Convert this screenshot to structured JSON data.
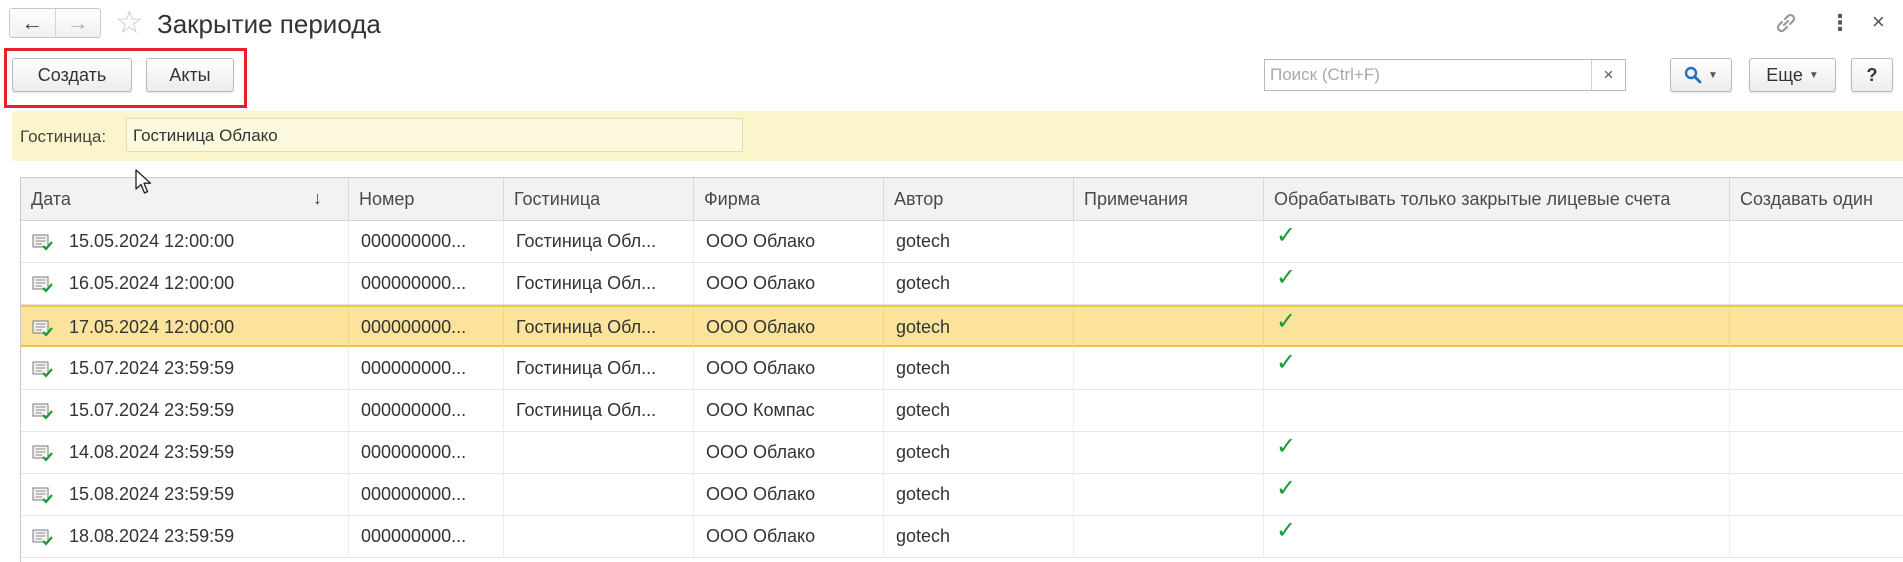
{
  "window": {
    "title": "Закрытие периода",
    "back_icon": "arrow-left-icon",
    "forward_icon": "arrow-right-icon",
    "favorite_icon": "star-icon",
    "link_icon": "link-icon",
    "more_icon": "vertical-dots-icon",
    "close_label": "×"
  },
  "toolbar": {
    "create_label": "Создать",
    "acts_label": "Акты",
    "search_placeholder": "Поиск (Ctrl+F)",
    "search_clear": "×",
    "find_icon": "magnifier-icon",
    "more_label": "Еще",
    "help_label": "?",
    "highlight_color": "#e8202a"
  },
  "filter": {
    "label": "Гостиница:",
    "value": "Гостиница Облако"
  },
  "table": {
    "columns": [
      "Дата",
      "Номер",
      "Гостиница",
      "Фирма",
      "Автор",
      "Примечания",
      "Обрабатывать только закрытые лицевые счета",
      "Создавать один"
    ],
    "sort_indicator": "↓",
    "selected_index": 2,
    "rows": [
      {
        "date": "15.05.2024 12:00:00",
        "number": "000000000...",
        "hotel": "Гостиница Обл...",
        "firm": "ООО Облако",
        "author": "gotech",
        "notes": "",
        "closed_only": true
      },
      {
        "date": "16.05.2024 12:00:00",
        "number": "000000000...",
        "hotel": "Гостиница Обл...",
        "firm": "ООО Облако",
        "author": "gotech",
        "notes": "",
        "closed_only": true
      },
      {
        "date": "17.05.2024 12:00:00",
        "number": "000000000...",
        "hotel": "Гостиница Обл...",
        "firm": "ООО Облако",
        "author": "gotech",
        "notes": "",
        "closed_only": true
      },
      {
        "date": "15.07.2024 23:59:59",
        "number": "000000000...",
        "hotel": "Гостиница Обл...",
        "firm": "ООО Облако",
        "author": "gotech",
        "notes": "",
        "closed_only": true
      },
      {
        "date": "15.07.2024 23:59:59",
        "number": "000000000...",
        "hotel": "Гостиница Обл...",
        "firm": "ООО Компас",
        "author": "gotech",
        "notes": "",
        "closed_only": false
      },
      {
        "date": "14.08.2024 23:59:59",
        "number": "000000000...",
        "hotel": "",
        "firm": "ООО Облако",
        "author": "gotech",
        "notes": "",
        "closed_only": true
      },
      {
        "date": "15.08.2024 23:59:59",
        "number": "000000000...",
        "hotel": "",
        "firm": "ООО Облако",
        "author": "gotech",
        "notes": "",
        "closed_only": true
      },
      {
        "date": "18.08.2024 23:59:59",
        "number": "000000000...",
        "hotel": "",
        "firm": "ООО Облако",
        "author": "gotech",
        "notes": "",
        "closed_only": true
      }
    ],
    "check_glyph": "✓",
    "row_icon": "posted-document-icon",
    "check_color": "#1a9a3a",
    "selected_row_color": "#fbe39c"
  }
}
